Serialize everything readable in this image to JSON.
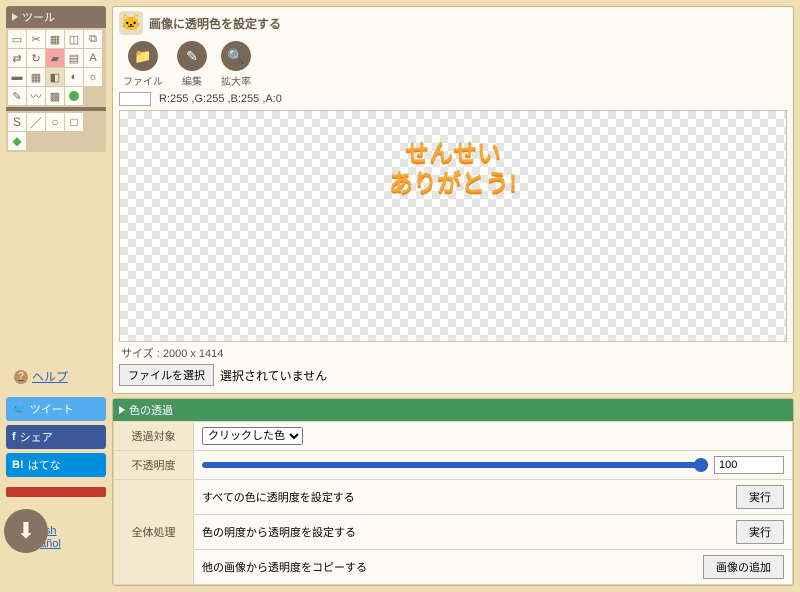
{
  "sidebar": {
    "title": "ツール",
    "help": "ヘルプ"
  },
  "social": {
    "twitter": "ツイート",
    "facebook": "シェア",
    "hatena": "はてな"
  },
  "lang": {
    "en": "lish",
    "es": "añol"
  },
  "header": {
    "title": "画像に透明色を設定する",
    "btn_file": "ファイル",
    "btn_edit": "編集",
    "btn_zoom": "拡大率"
  },
  "colorbar": {
    "text": "R:255 ,G:255 ,B:255 ,A:0"
  },
  "canvas": {
    "line1": "せんせい",
    "line2": "ありがとう!",
    "size": "サイズ : 2000 x 1414"
  },
  "file": {
    "choose": "ファイルを選択",
    "none": "選択されていません"
  },
  "opts": {
    "title": "色の透過",
    "target_label": "透過対象",
    "target_value": "クリックした色",
    "opacity_label": "不透明度",
    "opacity_value": "100",
    "global_label": "全体処理",
    "row1": "すべての色に透明度を設定する",
    "row2": "色の明度から透明度を設定する",
    "row3": "他の画像から透明度をコピーする",
    "exec": "実行",
    "add_image": "画像の追加"
  }
}
